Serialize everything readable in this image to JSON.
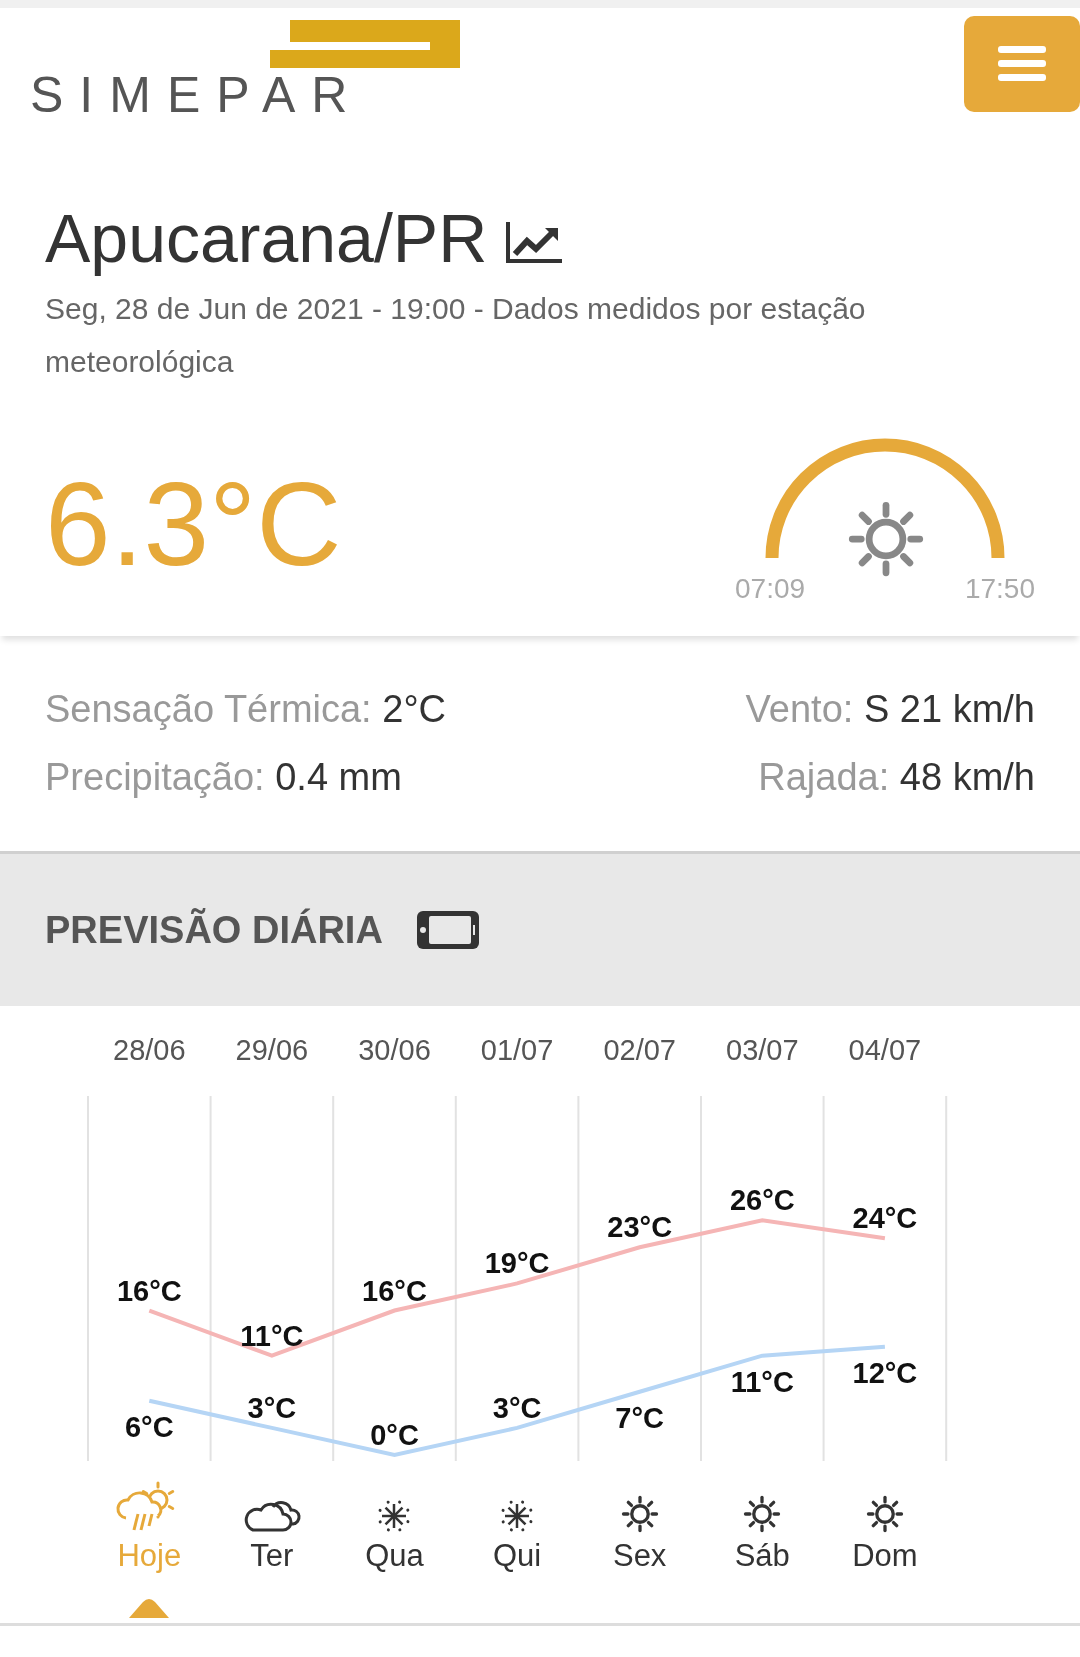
{
  "header": {
    "logo": "SIMEPAR"
  },
  "location": {
    "title": "Apucarana/PR",
    "subtitle": "Seg, 28 de Jun de 2021 - 19:00 - Dados medidos por estação meteorológica"
  },
  "current": {
    "temperature": "6.3°C",
    "sunrise": "07:09",
    "sunset": "17:50"
  },
  "details": [
    {
      "label": "Sensação Térmica:",
      "value": "2°C"
    },
    {
      "label": "Vento:",
      "value": "S 21 km/h"
    },
    {
      "label": "Precipitação:",
      "value": "0.4 mm"
    },
    {
      "label": "Rajada:",
      "value": "48 km/h"
    }
  ],
  "forecast": {
    "title": "PREVISÃO DIÁRIA",
    "chart_data": {
      "type": "line",
      "categories": [
        "28/06",
        "29/06",
        "30/06",
        "01/07",
        "02/07",
        "03/07",
        "04/07"
      ],
      "series": [
        {
          "color": "#f5b5b5",
          "values": [
            16,
            11,
            16,
            19,
            23,
            26,
            24
          ],
          "value_labels": [
            "16°C",
            "11°C",
            "16°C",
            "19°C",
            "23°C",
            "26°C",
            "24°C"
          ]
        },
        {
          "color": "#b5d5f5",
          "values": [
            6,
            3,
            0,
            3,
            7,
            11,
            12
          ],
          "value_labels": [
            "6°C",
            "3°C",
            "0°C",
            "3°C",
            "7°C",
            "11°C",
            "12°C"
          ]
        }
      ]
    },
    "days": [
      {
        "label": "Hoje",
        "kind": "rain",
        "selected": true
      },
      {
        "label": "Ter",
        "kind": "cloud",
        "selected": false
      },
      {
        "label": "Qua",
        "kind": "night",
        "selected": false
      },
      {
        "label": "Qui",
        "kind": "night",
        "selected": false
      },
      {
        "label": "Sex",
        "kind": "sun",
        "selected": false
      },
      {
        "label": "Sáb",
        "kind": "sun",
        "selected": false
      },
      {
        "label": "Dom",
        "kind": "sun",
        "selected": false
      }
    ]
  }
}
